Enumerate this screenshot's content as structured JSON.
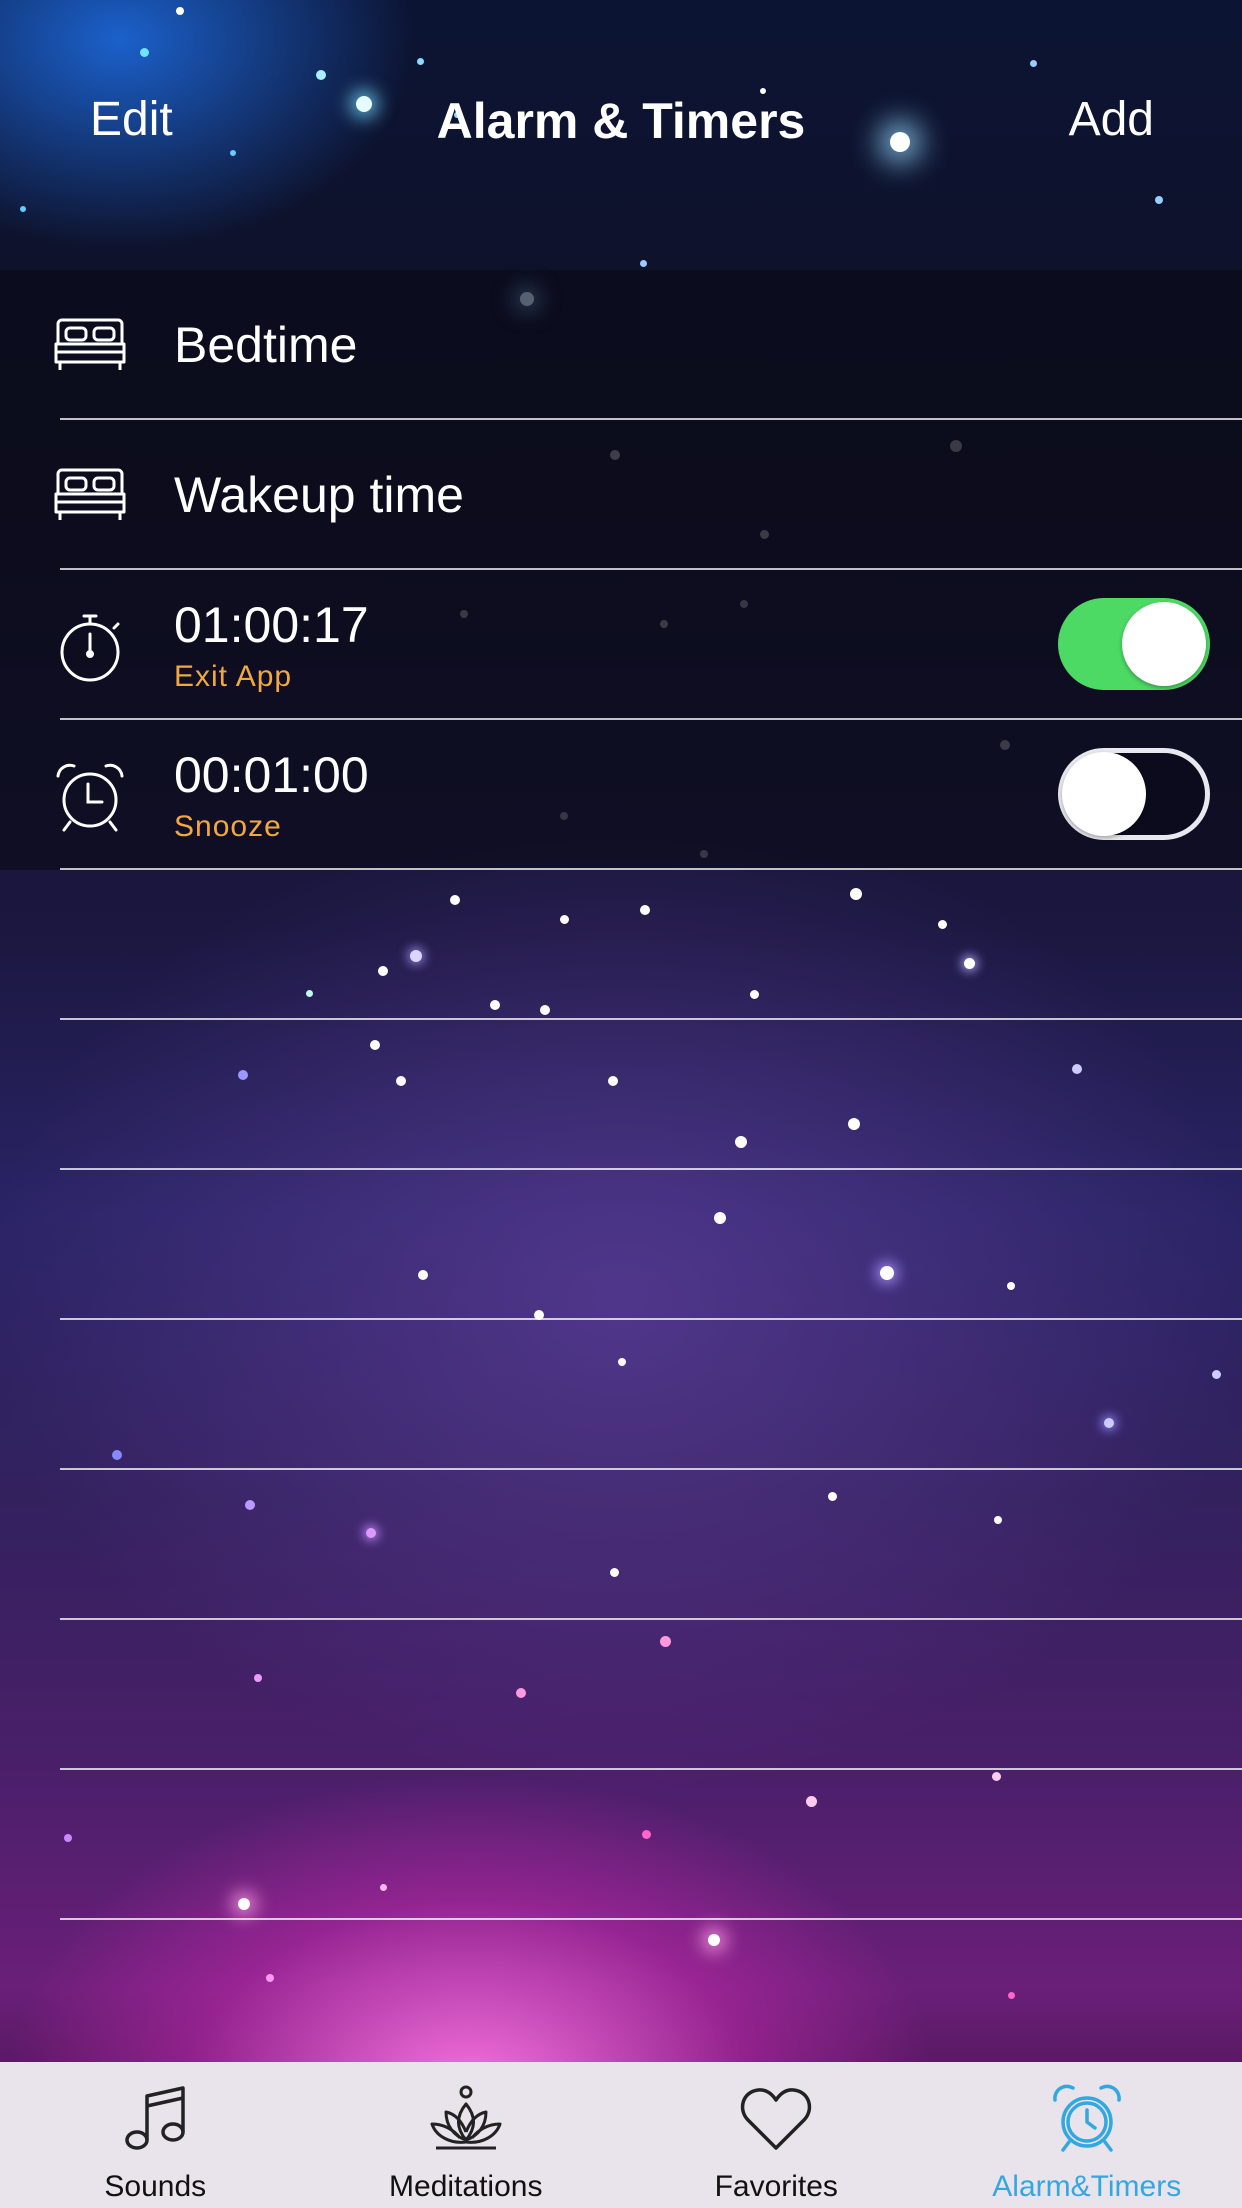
{
  "header": {
    "title": "Alarm & Timers",
    "edit_label": "Edit",
    "add_label": "Add"
  },
  "rows": [
    {
      "icon": "bed-icon",
      "title": "Bedtime"
    },
    {
      "icon": "bed-icon",
      "title": "Wakeup time"
    },
    {
      "icon": "stopwatch-icon",
      "time": "01:00:17",
      "subtitle": "Exit App",
      "toggle_on": true
    },
    {
      "icon": "alarm-clock-icon",
      "time": "00:01:00",
      "subtitle": "Snooze",
      "toggle_on": false
    }
  ],
  "tabs": [
    {
      "label": "Sounds",
      "icon": "music-note-icon"
    },
    {
      "label": "Meditations",
      "icon": "lotus-icon"
    },
    {
      "label": "Favorites",
      "icon": "heart-icon"
    },
    {
      "label": "Alarm&Timers",
      "icon": "alarm-clock-icon",
      "active": true
    }
  ],
  "colors": {
    "accent": "#33a8e0",
    "toggle_on": "#4cd964",
    "subtitle": "#f0a940",
    "tabbar_bg": "#e9e3ec"
  }
}
